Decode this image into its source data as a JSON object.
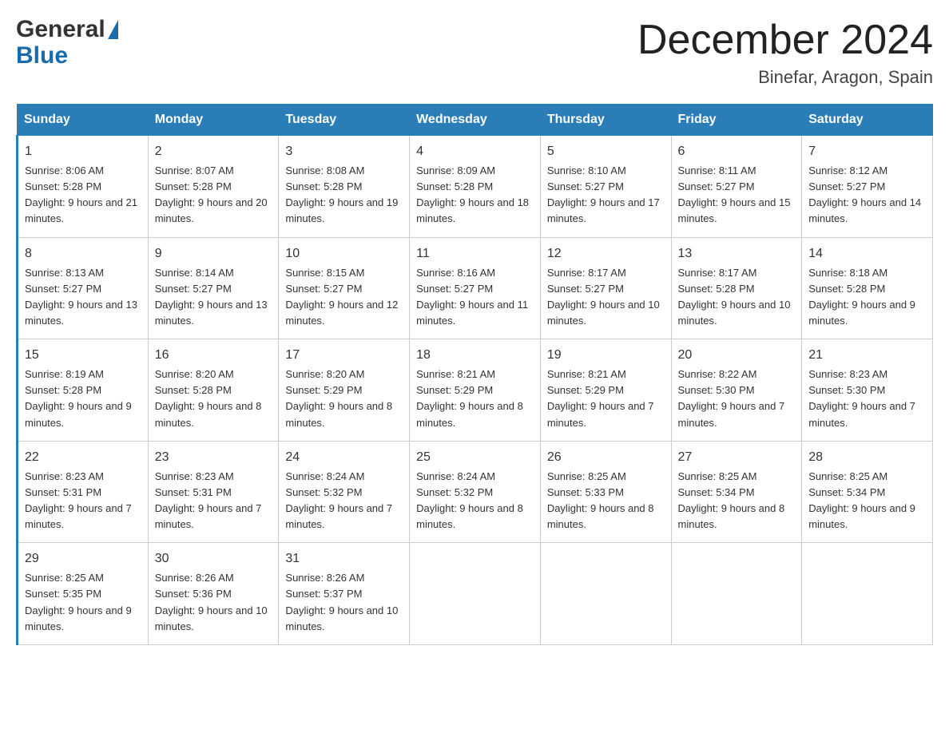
{
  "header": {
    "title": "December 2024",
    "location": "Binefar, Aragon, Spain",
    "logo_line1": "General",
    "logo_line2": "Blue"
  },
  "days_of_week": [
    "Sunday",
    "Monday",
    "Tuesday",
    "Wednesday",
    "Thursday",
    "Friday",
    "Saturday"
  ],
  "weeks": [
    [
      {
        "day": "1",
        "sunrise": "8:06 AM",
        "sunset": "5:28 PM",
        "daylight": "9 hours and 21 minutes."
      },
      {
        "day": "2",
        "sunrise": "8:07 AM",
        "sunset": "5:28 PM",
        "daylight": "9 hours and 20 minutes."
      },
      {
        "day": "3",
        "sunrise": "8:08 AM",
        "sunset": "5:28 PM",
        "daylight": "9 hours and 19 minutes."
      },
      {
        "day": "4",
        "sunrise": "8:09 AM",
        "sunset": "5:28 PM",
        "daylight": "9 hours and 18 minutes."
      },
      {
        "day": "5",
        "sunrise": "8:10 AM",
        "sunset": "5:27 PM",
        "daylight": "9 hours and 17 minutes."
      },
      {
        "day": "6",
        "sunrise": "8:11 AM",
        "sunset": "5:27 PM",
        "daylight": "9 hours and 15 minutes."
      },
      {
        "day": "7",
        "sunrise": "8:12 AM",
        "sunset": "5:27 PM",
        "daylight": "9 hours and 14 minutes."
      }
    ],
    [
      {
        "day": "8",
        "sunrise": "8:13 AM",
        "sunset": "5:27 PM",
        "daylight": "9 hours and 13 minutes."
      },
      {
        "day": "9",
        "sunrise": "8:14 AM",
        "sunset": "5:27 PM",
        "daylight": "9 hours and 13 minutes."
      },
      {
        "day": "10",
        "sunrise": "8:15 AM",
        "sunset": "5:27 PM",
        "daylight": "9 hours and 12 minutes."
      },
      {
        "day": "11",
        "sunrise": "8:16 AM",
        "sunset": "5:27 PM",
        "daylight": "9 hours and 11 minutes."
      },
      {
        "day": "12",
        "sunrise": "8:17 AM",
        "sunset": "5:27 PM",
        "daylight": "9 hours and 10 minutes."
      },
      {
        "day": "13",
        "sunrise": "8:17 AM",
        "sunset": "5:28 PM",
        "daylight": "9 hours and 10 minutes."
      },
      {
        "day": "14",
        "sunrise": "8:18 AM",
        "sunset": "5:28 PM",
        "daylight": "9 hours and 9 minutes."
      }
    ],
    [
      {
        "day": "15",
        "sunrise": "8:19 AM",
        "sunset": "5:28 PM",
        "daylight": "9 hours and 9 minutes."
      },
      {
        "day": "16",
        "sunrise": "8:20 AM",
        "sunset": "5:28 PM",
        "daylight": "9 hours and 8 minutes."
      },
      {
        "day": "17",
        "sunrise": "8:20 AM",
        "sunset": "5:29 PM",
        "daylight": "9 hours and 8 minutes."
      },
      {
        "day": "18",
        "sunrise": "8:21 AM",
        "sunset": "5:29 PM",
        "daylight": "9 hours and 8 minutes."
      },
      {
        "day": "19",
        "sunrise": "8:21 AM",
        "sunset": "5:29 PM",
        "daylight": "9 hours and 7 minutes."
      },
      {
        "day": "20",
        "sunrise": "8:22 AM",
        "sunset": "5:30 PM",
        "daylight": "9 hours and 7 minutes."
      },
      {
        "day": "21",
        "sunrise": "8:23 AM",
        "sunset": "5:30 PM",
        "daylight": "9 hours and 7 minutes."
      }
    ],
    [
      {
        "day": "22",
        "sunrise": "8:23 AM",
        "sunset": "5:31 PM",
        "daylight": "9 hours and 7 minutes."
      },
      {
        "day": "23",
        "sunrise": "8:23 AM",
        "sunset": "5:31 PM",
        "daylight": "9 hours and 7 minutes."
      },
      {
        "day": "24",
        "sunrise": "8:24 AM",
        "sunset": "5:32 PM",
        "daylight": "9 hours and 7 minutes."
      },
      {
        "day": "25",
        "sunrise": "8:24 AM",
        "sunset": "5:32 PM",
        "daylight": "9 hours and 8 minutes."
      },
      {
        "day": "26",
        "sunrise": "8:25 AM",
        "sunset": "5:33 PM",
        "daylight": "9 hours and 8 minutes."
      },
      {
        "day": "27",
        "sunrise": "8:25 AM",
        "sunset": "5:34 PM",
        "daylight": "9 hours and 8 minutes."
      },
      {
        "day": "28",
        "sunrise": "8:25 AM",
        "sunset": "5:34 PM",
        "daylight": "9 hours and 9 minutes."
      }
    ],
    [
      {
        "day": "29",
        "sunrise": "8:25 AM",
        "sunset": "5:35 PM",
        "daylight": "9 hours and 9 minutes."
      },
      {
        "day": "30",
        "sunrise": "8:26 AM",
        "sunset": "5:36 PM",
        "daylight": "9 hours and 10 minutes."
      },
      {
        "day": "31",
        "sunrise": "8:26 AM",
        "sunset": "5:37 PM",
        "daylight": "9 hours and 10 minutes."
      },
      null,
      null,
      null,
      null
    ]
  ]
}
